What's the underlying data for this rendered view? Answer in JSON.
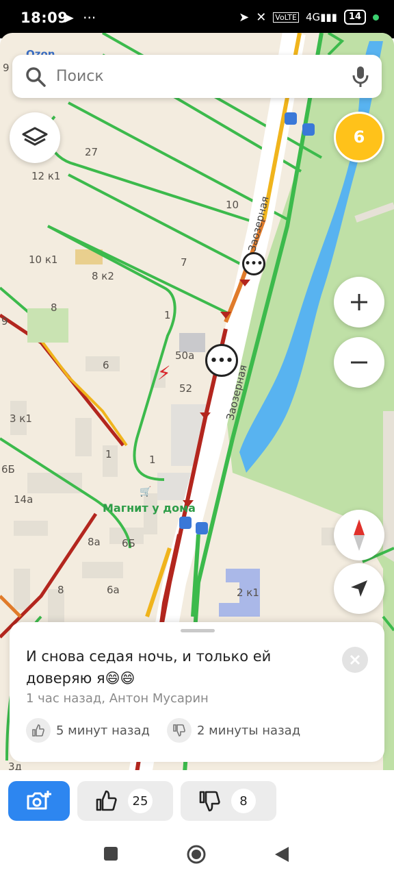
{
  "status_bar": {
    "time": "18:09",
    "left_icons": [
      "telegram-icon",
      "more-icon"
    ],
    "battery": "14",
    "right_icons": [
      "location-icon",
      "vibrate-off-icon",
      "volte-icon",
      "signal-4g-icon"
    ]
  },
  "search": {
    "placeholder": "Поиск"
  },
  "traffic_level": "6",
  "map": {
    "labels": {
      "ozon": "Ozon",
      "n9a": "9",
      "n27": "27",
      "n12k1": "12 к1",
      "n10": "10",
      "n10k1": "10 к1",
      "n7": "7",
      "n8k2": "8 к2",
      "n8": "8",
      "n1a": "1",
      "n50a": "50а",
      "n9b": "9",
      "n6": "6",
      "n52": "52",
      "n3k1": "3 к1",
      "n1b": "1",
      "n1c": "1",
      "n6b1": "6Б",
      "n14a": "14а",
      "n8a": "8а",
      "n6b2": "6Б",
      "n8b": "8",
      "n6a": "6а",
      "n2k1": "2 к1",
      "n3d": "3д"
    },
    "streets": [
      "Заозерная",
      "Заозерная"
    ],
    "poi": "Магнит у дома",
    "accent_colors": {
      "jam": "#b3261e",
      "slow": "#f0b41c",
      "free": "#3cba4c",
      "park": "#b9dca0",
      "water": "#5ab4f2"
    }
  },
  "card": {
    "comment": "И снова седая ночь, и только ей доверяю я😄😄",
    "meta": "1 час назад, Антон Мусарин",
    "like_time": "5 минут назад",
    "dislike_time": "2 минуты назад"
  },
  "actions": {
    "like_count": "25",
    "dislike_count": "8"
  }
}
